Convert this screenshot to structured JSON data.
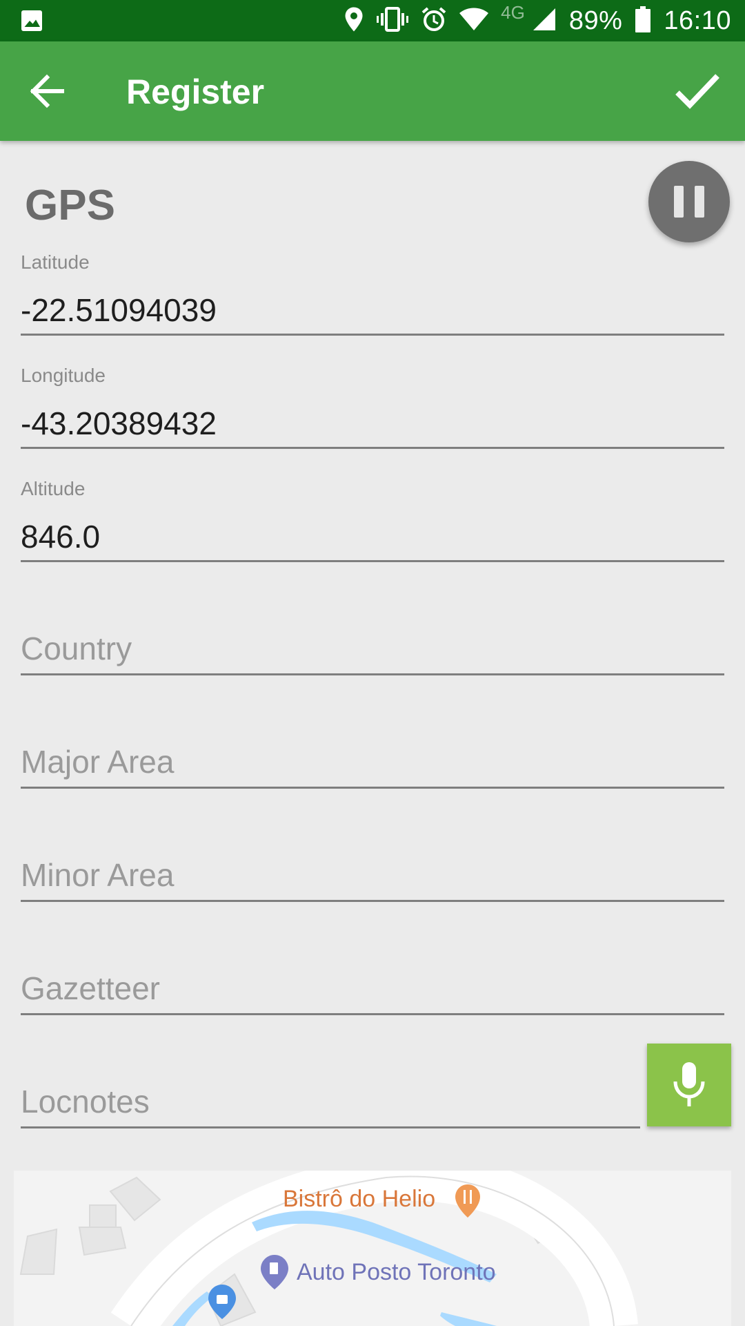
{
  "status_bar": {
    "battery": "89%",
    "time": "16:10",
    "network": "4G",
    "icons": [
      "image-icon",
      "location-icon",
      "vibrate-icon",
      "alarm-icon",
      "wifi-icon",
      "cell-signal-icon",
      "battery-icon"
    ]
  },
  "appbar": {
    "title": "Register",
    "back_icon": "arrow-back-icon",
    "confirm_icon": "check-icon"
  },
  "gps": {
    "title": "GPS",
    "pause_icon": "pause-icon"
  },
  "fields": {
    "latitude": {
      "label": "Latitude",
      "value": "-22.51094039"
    },
    "longitude": {
      "label": "Longitude",
      "value": "-43.20389432"
    },
    "altitude": {
      "label": "Altitude",
      "value": "846.0"
    },
    "country": {
      "placeholder": "Country"
    },
    "major_area": {
      "placeholder": "Major Area"
    },
    "minor_area": {
      "placeholder": "Minor Area"
    },
    "gazetteer": {
      "placeholder": "Gazetteer"
    },
    "locnotes": {
      "placeholder": "Locnotes"
    }
  },
  "mic_icon": "microphone-icon",
  "map": {
    "places": [
      "Bistrô do Helio",
      "Auto Posto Toronto"
    ],
    "colors": {
      "restaurant": "#d9773a",
      "gas": "#7b7fc6",
      "water": "#aadaff"
    }
  },
  "colors": {
    "status_bar": "#0d6b17",
    "app_bar": "#47a447",
    "mic_button": "#8bc34a",
    "pause_button": "#6f6f6f",
    "background": "#ebebeb"
  }
}
